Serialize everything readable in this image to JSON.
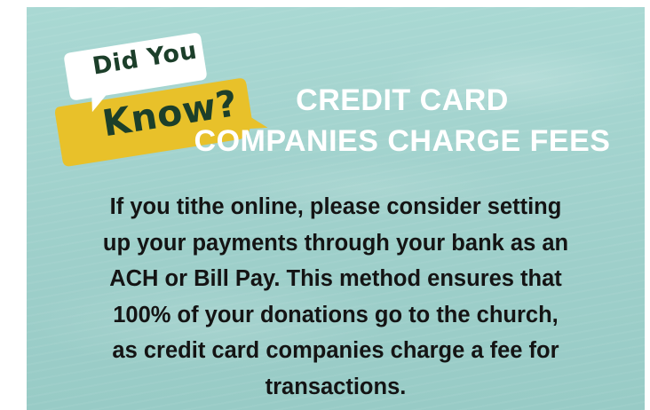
{
  "badge": {
    "line1": "Did You",
    "line2": "Know?",
    "colors": {
      "white_bubble": "#ffffff",
      "yellow_bubble": "#e8c12a",
      "text": "#1c3f2a"
    }
  },
  "headline": {
    "lines": [
      "CREDIT CARD",
      "COMPANIES CHARGE FEES"
    ],
    "color": "#ffffff"
  },
  "body": {
    "lines": [
      "If you tithe online, please consider setting",
      "up your payments through your bank as an",
      "ACH or Bill Pay. This method ensures that",
      "100% of your donations go to the church,",
      "as credit card companies charge a fee for",
      "transactions."
    ],
    "color": "#141414"
  },
  "background": {
    "color": "#a4d4cf"
  }
}
